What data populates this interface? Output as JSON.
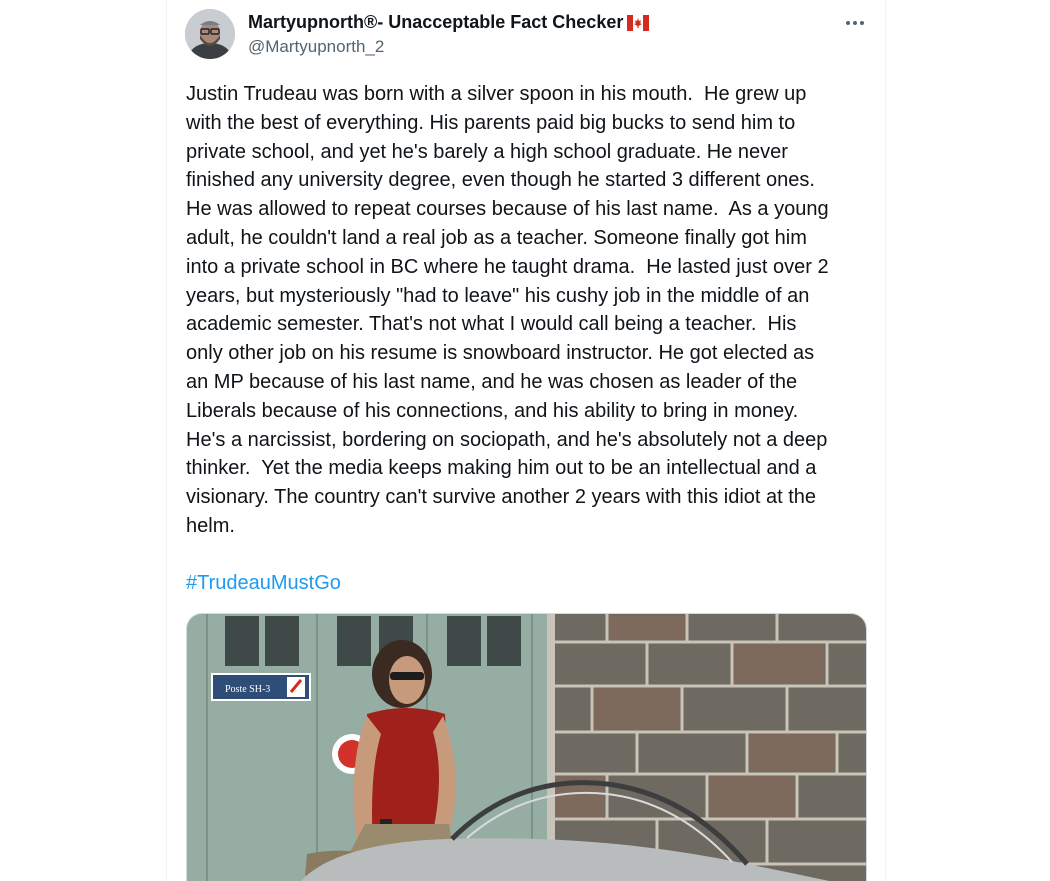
{
  "tweet": {
    "author": {
      "display_name": "Martyupnorth®- Unacceptable Fact Checker",
      "handle": "@Martyupnorth_2",
      "flag_icon": "canada-flag-icon"
    },
    "text": "Justin Trudeau was born with a silver spoon in his mouth.  He grew up\nwith the best of everything. His parents paid big bucks to send him to\nprivate school, and yet he's barely a high school graduate. He never\nfinished any university degree, even though he started 3 different ones.\nHe was allowed to repeat courses because of his last name.  As a young\nadult, he couldn't land a real job as a teacher. Someone finally got him\ninto a private school in BC where he taught drama.  He lasted just over 2\nyears, but mysteriously \"had to leave\" his cushy job in the middle of an\nacademic semester. That's not what I would call being a teacher.  His\nonly other job on his resume is snowboard instructor. He got elected as\nan MP because of his last name, and he was chosen as leader of the\nLiberals because of his connections, and his ability to bring in money.\nHe's a narcissist, bordering on sociopath, and he's absolutely not a deep\nthinker.  Yet the media keeps making him out to be an intellectual and a\nvisionary. The country can't survive another 2 years with this idiot at the\nhelm.",
    "hashtag": "#TrudeauMustGo",
    "media": {
      "sign_text": "Poste SH-3"
    }
  },
  "colors": {
    "text": "#0f1419",
    "secondary": "#536471",
    "link": "#1d9bf0",
    "border": "#eff3f4"
  },
  "icons": {
    "more": "more-horizontal-icon"
  }
}
